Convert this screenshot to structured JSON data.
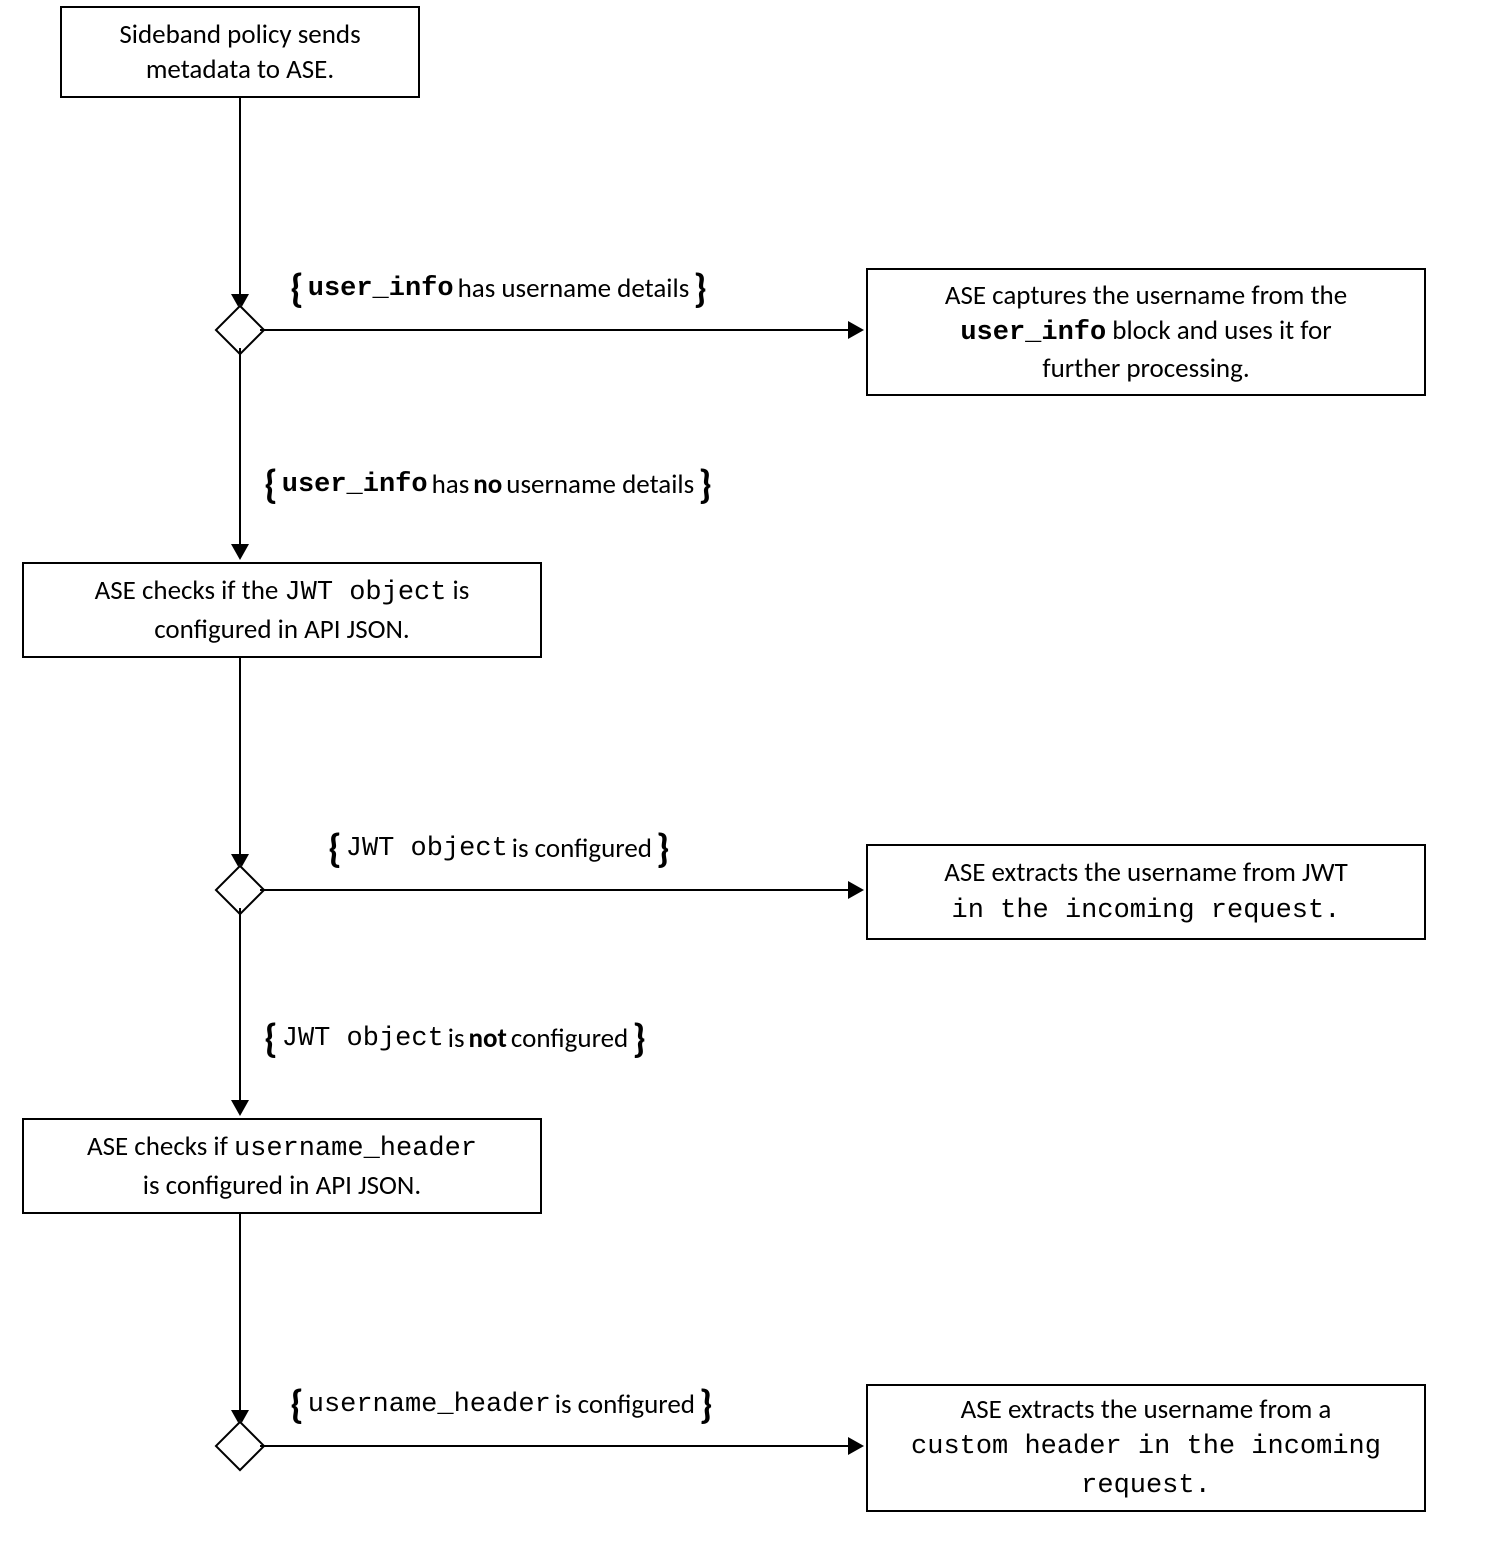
{
  "chart_data": {
    "type": "flowchart",
    "nodes": [
      {
        "id": "start",
        "type": "process",
        "text": "Sideband policy sends metadata to ASE."
      },
      {
        "id": "d1",
        "type": "decision",
        "condition_yes": "user_info has username details",
        "condition_no": "user_info has no username details"
      },
      {
        "id": "r1",
        "type": "process",
        "text": "ASE captures the username from the user_info block and uses it for further processing."
      },
      {
        "id": "p2",
        "type": "process",
        "text": "ASE checks if the JWT object is configured in API JSON."
      },
      {
        "id": "d2",
        "type": "decision",
        "condition_yes": "JWT object is configured",
        "condition_no": "JWT object is not configured"
      },
      {
        "id": "r2",
        "type": "process",
        "text": "ASE extracts the username from JWT in the incoming request."
      },
      {
        "id": "p3",
        "type": "process",
        "text": "ASE checks if username_header is configured in API JSON."
      },
      {
        "id": "d3",
        "type": "decision",
        "condition_yes": "username_header is configured"
      },
      {
        "id": "r3",
        "type": "process",
        "text": "ASE extracts the username from a custom header in the incoming request."
      }
    ],
    "edges": [
      {
        "from": "start",
        "to": "d1"
      },
      {
        "from": "d1",
        "to": "r1",
        "label": "user_info has username details"
      },
      {
        "from": "d1",
        "to": "p2",
        "label": "user_info has no username details"
      },
      {
        "from": "p2",
        "to": "d2"
      },
      {
        "from": "d2",
        "to": "r2",
        "label": "JWT object is configured"
      },
      {
        "from": "d2",
        "to": "p3",
        "label": "JWT object is not configured"
      },
      {
        "from": "p3",
        "to": "d3"
      },
      {
        "from": "d3",
        "to": "r3",
        "label": "username_header is configured"
      }
    ]
  },
  "boxes": {
    "start_l1": "Sideband policy  sends",
    "start_l2": "metadata to ASE.",
    "r1_l1": "ASE captures the username from the",
    "r1_l2a": "user_info",
    "r1_l2b": " block and uses it for",
    "r1_l3": "further processing.",
    "p2_l1a": "ASE checks if the ",
    "p2_l1b": "JWT object",
    "p2_l1c": " is",
    "p2_l2": "configured in API JSON.",
    "r2_l1": "ASE extracts the username from JWT",
    "r2_l2": "in the incoming request.",
    "p3_l1a": "ASE checks if ",
    "p3_l1b": "username_header",
    "p3_l2": "is configured in API JSON.",
    "r3_l1": "ASE extracts the username from a",
    "r3_l2": "custom header in the incoming",
    "r3_l3": "request."
  },
  "conds": {
    "c1y_a": "user_info",
    "c1y_b": "  has username details",
    "c1n_a": "user_info",
    "c1n_b": "  has ",
    "c1n_c": "no",
    "c1n_d": " username details",
    "c2y_a": "JWT object",
    "c2y_b": "  is configured",
    "c2n_a": "JWT object",
    "c2n_b": "  is ",
    "c2n_c": "not",
    "c2n_d": " configured",
    "c3y_a": "username_header",
    "c3y_b": "  is configured"
  },
  "brace_open": "{",
  "brace_close": "}"
}
